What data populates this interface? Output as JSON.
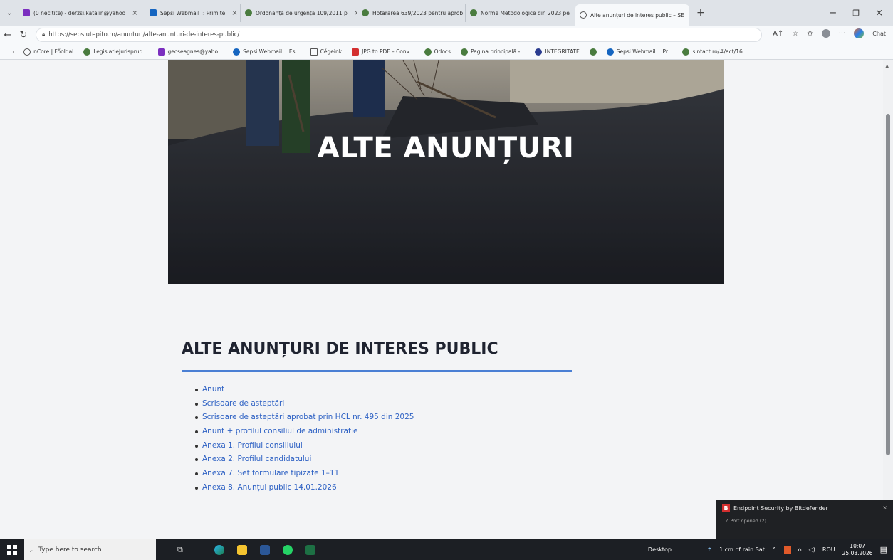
{
  "browser": {
    "tabs": [
      {
        "label": "(0 necitite) - derzsi.katalin@yahoo",
        "color": "#7b2fbf"
      },
      {
        "label": "Sepsi Webmail :: Primite",
        "color": "#1565c0"
      },
      {
        "label": "Ordonanță de urgență 109/2011 p",
        "color": "#4a7c3f"
      },
      {
        "label": "Hotararea 639/2023 pentru aprob",
        "color": "#4a7c3f"
      },
      {
        "label": "Norme Metodologice din 2023 pe",
        "color": "#4a7c3f"
      },
      {
        "label": "Alte anunțuri de interes public – SE",
        "color": "#555555"
      }
    ],
    "new_tab": "+",
    "url": "https://sepsiutepito.ro/anunturi/alte-anunturi-de-interes-public/",
    "chat_label": "Chat",
    "bookmarks": [
      "nCore | Főoldal",
      "LegislatieJurisprud...",
      "gecseagnes@yaho...",
      "Sepsi Webmail :: Es...",
      "Cégeink",
      "JPG to PDF – Conv...",
      "Odocs",
      "Pagina principală -...",
      "INTEGRITATE",
      "Sepsi Webmail :: Pr...",
      "sintact.ro/#/act/16..."
    ]
  },
  "page": {
    "hero_title": "ALTE ANUNȚURI",
    "section_title": "ALTE ANUNȚURI DE INTERES PUBLIC",
    "accent_color": "#4a7fd4",
    "links": [
      "Anunt",
      "Scrisoare de asteptări",
      "Scrisoare de asteptări aprobat prin HCL nr. 495 din 2025",
      "Anunt + profilul consiliul de administratie",
      "Anexa 1. Profilul consiliului",
      "Anexa 2. Profilul candidatului",
      "Anexa 7. Set formulare tipizate 1–11",
      "Anexa 8. Anunțul public 14.01.2026"
    ]
  },
  "notification": {
    "title": "Endpoint Security by Bitdefender",
    "message": "Port opened (2)"
  },
  "taskbar": {
    "search_placeholder": "Type here to search",
    "desktop_label": "Desktop",
    "weather": "1 cm of rain Sat",
    "language": "ROU",
    "time": "10:07",
    "date": "25.03.2026"
  }
}
